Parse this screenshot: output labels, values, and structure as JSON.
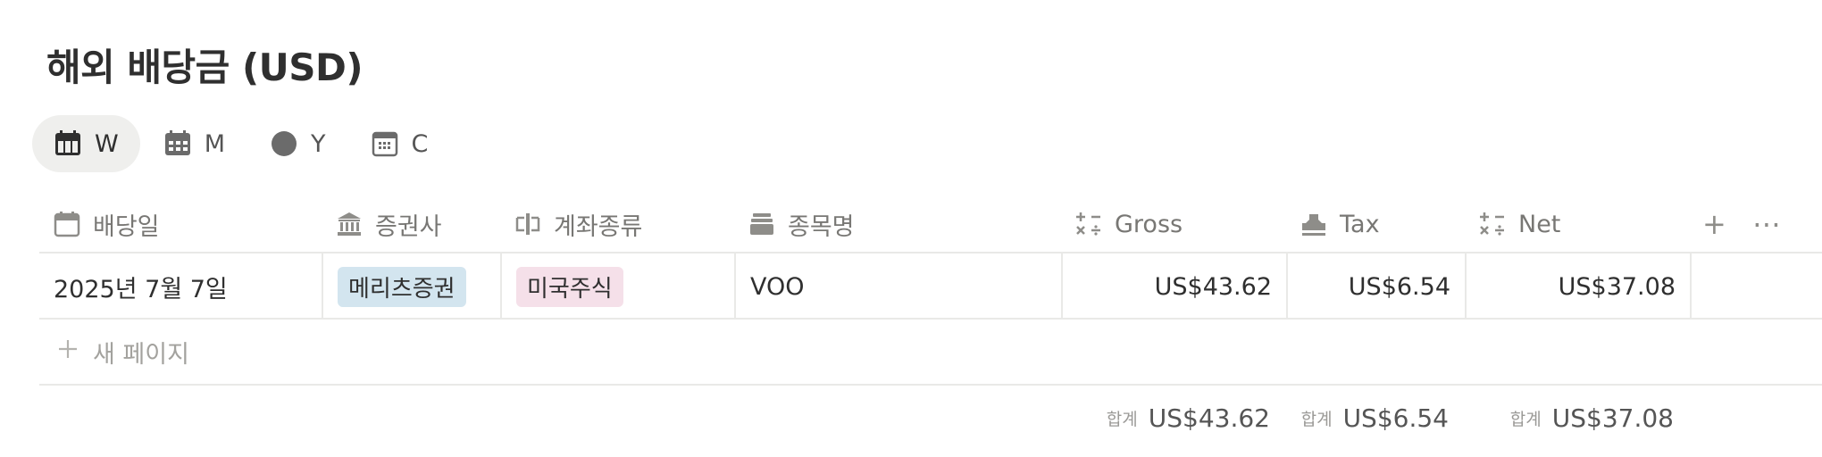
{
  "page": {
    "title": "해외 배당금 (USD)"
  },
  "views": [
    {
      "label": "W",
      "icon": "calendar-week-icon",
      "active": true
    },
    {
      "label": "M",
      "icon": "calendar-month-icon",
      "active": false
    },
    {
      "label": "Y",
      "icon": "circle-icon",
      "active": false
    },
    {
      "label": "C",
      "icon": "calendar-icon",
      "active": false
    }
  ],
  "table": {
    "columns": [
      {
        "label": "배당일",
        "icon": "calendar-icon"
      },
      {
        "label": "증권사",
        "icon": "bank-icon"
      },
      {
        "label": "계좌종류",
        "icon": "balance-icon"
      },
      {
        "label": "종목명",
        "icon": "stack-icon"
      },
      {
        "label": "Gross",
        "icon": "formula-icon"
      },
      {
        "label": "Tax",
        "icon": "stamp-icon"
      },
      {
        "label": "Net",
        "icon": "formula-icon"
      }
    ],
    "rows": [
      {
        "date": "2025년 7월 7일",
        "broker": {
          "label": "메리츠증권",
          "color": "#d3e5ef"
        },
        "account": {
          "label": "미국주식",
          "color": "#f5e0e9"
        },
        "ticker": "VOO",
        "gross": "US$43.62",
        "tax": "US$6.54",
        "net": "US$37.08"
      }
    ],
    "new_page_label": "새 페이지",
    "add_column_icon": "plus-icon",
    "more_icon": "more-horizontal-icon"
  },
  "summary": {
    "label": "합계",
    "gross": "US$43.62",
    "tax": "US$6.54",
    "net": "US$37.08"
  },
  "colors": {
    "text": "#37352f",
    "muted": "#787774",
    "border": "#e9e9e7",
    "active_tab": "#efefed"
  }
}
